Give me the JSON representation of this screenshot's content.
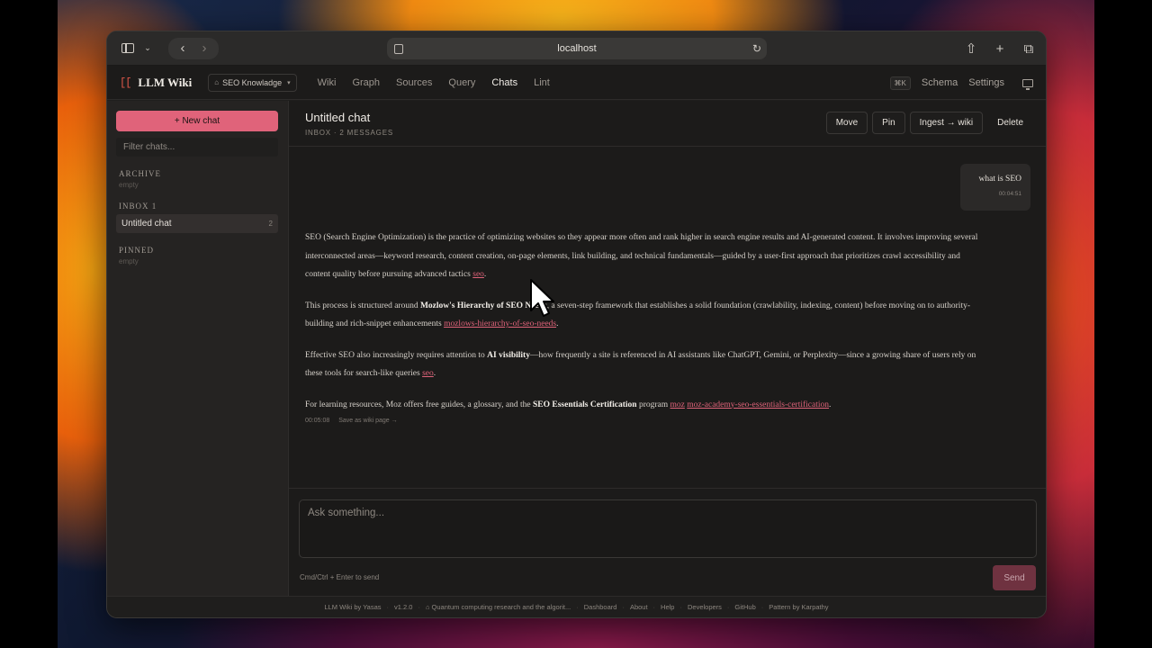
{
  "browser": {
    "url": "localhost",
    "icons": [
      "sidebar-icon",
      "chevron-down-icon",
      "back-icon",
      "forward-icon",
      "page-icon",
      "reload-icon",
      "share-icon",
      "new-tab-icon",
      "tabs-icon"
    ]
  },
  "app": {
    "logo_mark": "[[",
    "name": "LLM Wiki",
    "knowledge_base": "SEO Knowladge",
    "tabs": [
      {
        "label": "Wiki"
      },
      {
        "label": "Graph"
      },
      {
        "label": "Sources"
      },
      {
        "label": "Query"
      },
      {
        "label": "Chats"
      },
      {
        "label": "Lint"
      }
    ],
    "active_tab": "Chats",
    "shortcut": "⌘K",
    "schema_label": "Schema",
    "settings_label": "Settings"
  },
  "sidebar": {
    "new_chat_label": "+ New chat",
    "filter_placeholder": "Filter chats...",
    "groups": {
      "archive": {
        "title": "ARCHIVE",
        "empty": "empty"
      },
      "inbox": {
        "title": "INBOX 1",
        "item_label": "Untitled chat",
        "item_count": "2"
      },
      "pinned": {
        "title": "PINNED",
        "empty": "empty"
      }
    }
  },
  "chat": {
    "title": "Untitled chat",
    "meta": "INBOX · 2 MESSAGES",
    "actions": {
      "move": "Move",
      "pin": "Pin",
      "ingest": "Ingest → wiki",
      "delete": "Delete"
    },
    "user_message": {
      "text": "what is SEO",
      "time": "00:04:51"
    },
    "assistant": {
      "p1": "SEO (Search Engine Optimization) is the practice of optimizing websites so they appear more often and rank higher in search engine results and AI-generated content. It involves improving several interconnected areas—keyword research, content creation, on-page elements, link building, and technical fundamentals—guided by a user-first approach that prioritizes crawl accessibility and content quality before pursuing advanced tactics",
      "p1_ref": "seo",
      "p2_pre": "This process is structured around",
      "p2_bold": "Mozlow's Hierarchy of SEO Needs",
      "p2_post": ", a seven-step framework that establishes a solid foundation (crawlability, indexing, content) before moving on to authority-building and rich-snippet enhancements",
      "p2_ref": "mozlows-hierarchy-of-seo-needs",
      "p3_pre": "Effective SEO also increasingly requires attention to",
      "p3_bold": "AI visibility",
      "p3_post": "—how frequently a site is referenced in AI assistants like ChatGPT, Gemini, or Perplexity—since a growing share of users rely on these tools for search-like queries",
      "p3_ref": "seo",
      "p4_pre": "For learning resources, Moz offers free guides, a glossary, and the",
      "p4_bold": "SEO Essentials Certification",
      "p4_mid": "program",
      "p4_ref1": "moz",
      "p4_ref2": "moz-academy-seo-essentials-certification",
      "time": "00:05:08",
      "save_label": "Save as wiki page →"
    },
    "composer_placeholder": "Ask something...",
    "composer_hint": "Cmd/Ctrl + Enter to send",
    "send_label": "Send"
  },
  "footer": {
    "items": [
      "LLM Wiki by Yasas",
      "v1.2.0",
      "⌂ Quantum computing research and the algorit...",
      "Dashboard",
      "About",
      "Help",
      "Developers",
      "GitHub",
      "Pattern by Karpathy"
    ]
  },
  "colors": {
    "accent": "#e0637a",
    "background": "#1c1b1a",
    "sidebar": "#252322",
    "text": "#d6d1ca"
  }
}
